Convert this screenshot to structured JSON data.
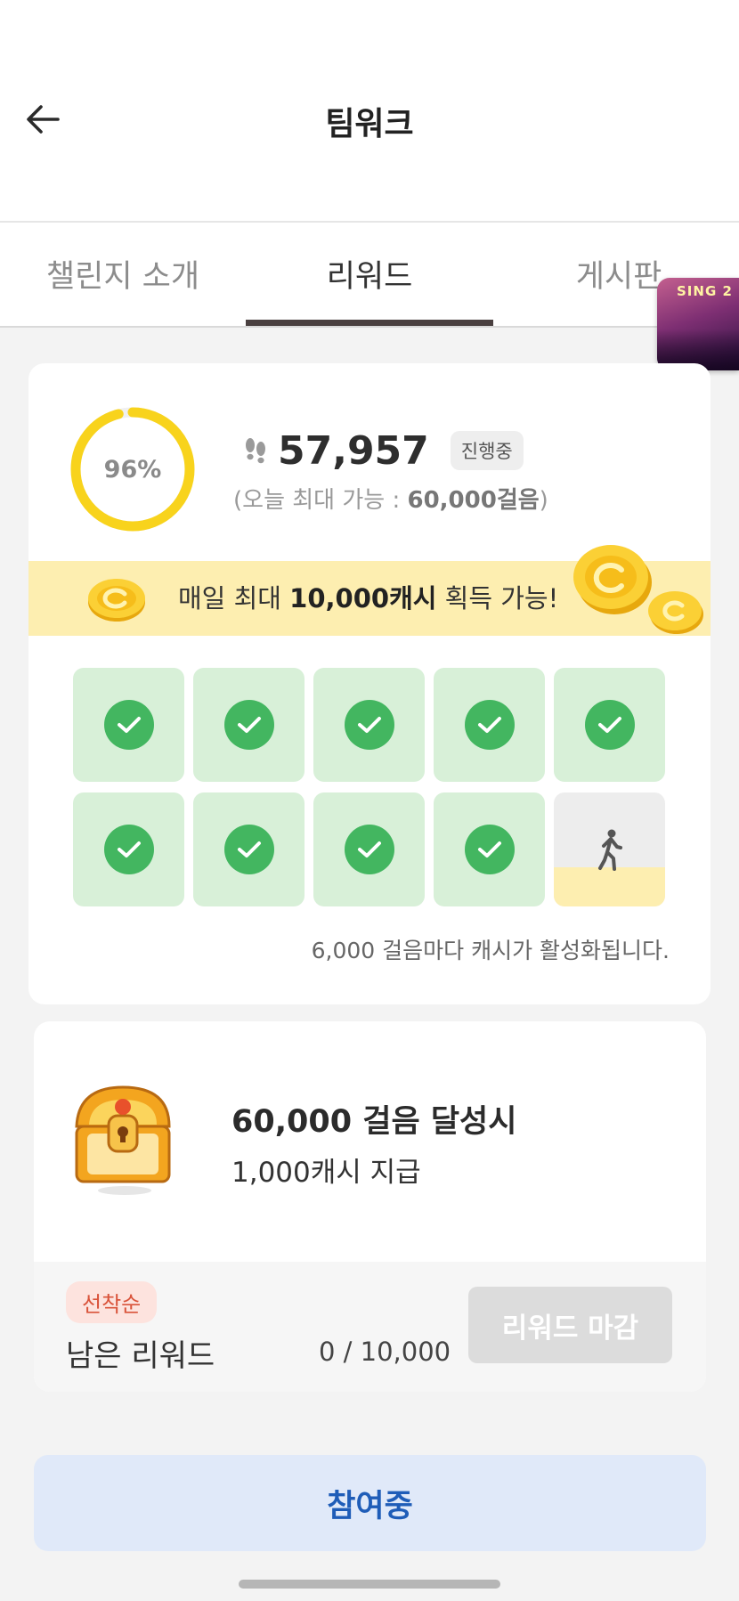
{
  "header": {
    "title": "팀워크"
  },
  "tabs": [
    {
      "label": "챌린지 소개"
    },
    {
      "label": "리워드"
    },
    {
      "label": "게시판"
    }
  ],
  "floating_thumb": {
    "title": "SING 2"
  },
  "progress": {
    "percent_label": "96%",
    "percent": 0.96,
    "steps": "57,957",
    "status": "진행중",
    "max_prefix": "(오늘 최대 가능 : ",
    "max_value": "60,000걸음",
    "max_suffix": ")"
  },
  "banner": {
    "prefix": "매일 최대 ",
    "highlight": "10,000캐시",
    "suffix": " 획득 가능!"
  },
  "step_grid": {
    "cells": [
      {
        "state": "done"
      },
      {
        "state": "done"
      },
      {
        "state": "done"
      },
      {
        "state": "done"
      },
      {
        "state": "done"
      },
      {
        "state": "done"
      },
      {
        "state": "done"
      },
      {
        "state": "done"
      },
      {
        "state": "done"
      },
      {
        "state": "pending",
        "fill": 0.34
      }
    ],
    "note": "6,000 걸음마다 캐시가 활성화됩니다."
  },
  "milestone": {
    "title": "60,000 걸음 달성시",
    "reward": "1,000캐시 지급",
    "badge": "선착순",
    "remaining_label": "남은 리워드",
    "remaining_count": "0 / 10,000",
    "button_label": "리워드 마감"
  },
  "join_button": {
    "label": "참여중"
  },
  "colors": {
    "ring": "#f8d31c",
    "check": "#43b660",
    "cell_done": "#d8f0d8",
    "banner": "#fdeeb0",
    "join_text": "#1f5db8"
  }
}
